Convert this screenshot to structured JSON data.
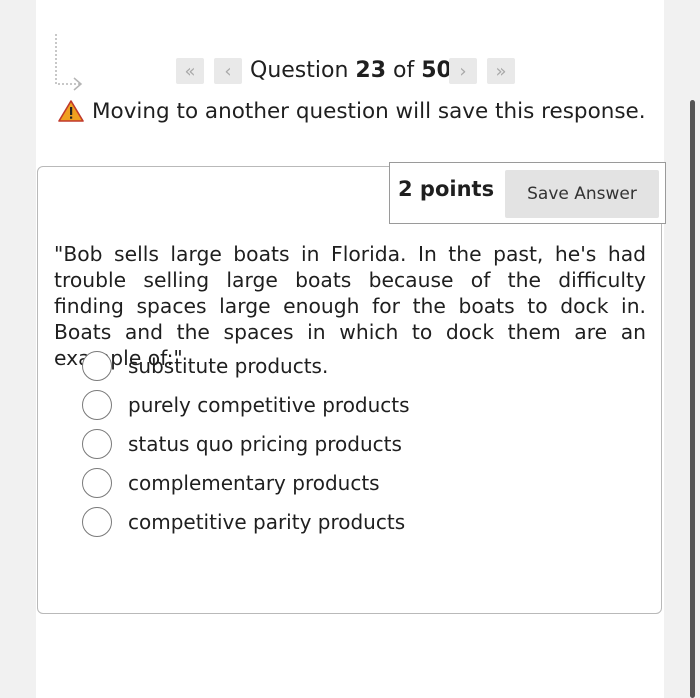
{
  "nav": {
    "first_icon": "double-chevron-left-icon",
    "prev_icon": "chevron-left-icon",
    "next_icon": "chevron-right-icon",
    "last_icon": "double-chevron-right-icon",
    "question_word": "Question",
    "current": "23",
    "of_word": "of",
    "total": "50"
  },
  "warning": {
    "icon": "warning-triangle-icon",
    "text": "Moving to another question will save this response."
  },
  "question_header": {
    "points": "2 points",
    "save_label": "Save Answer"
  },
  "question_text": "\"Bob sells large boats in Florida. In the past, he's had trouble selling large boats because of the difficulty finding spaces large enough for the boats to dock in. Boats and the spaces in which to dock them are an example of:\"",
  "options": [
    "substitute products.",
    "purely competitive products",
    "status quo pricing products",
    "complementary products",
    "competitive parity products"
  ],
  "colors": {
    "warning_fill": "#f0a020",
    "button_bg": "#e3e3e3",
    "border": "#b9b9b9"
  }
}
